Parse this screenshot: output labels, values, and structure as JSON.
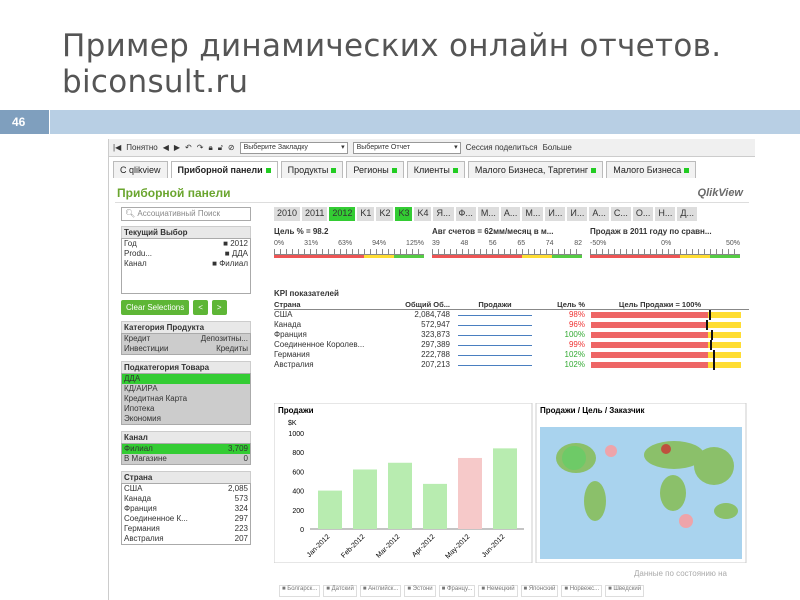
{
  "slide": {
    "title_line1": "Пример динамических онлайн отчетов.",
    "title_line2": "biconsult.ru",
    "page_num": "46"
  },
  "toolbar": {
    "understood": "Понятно",
    "bookmark": "Выберите Закладку",
    "report": "Выберите Отчет",
    "share": "Сессия поделиться",
    "more": "Больше"
  },
  "tabs": [
    "C qlikview",
    "Приборной панели",
    "Продукты",
    "Регионы",
    "Клиенты",
    "Малого Бизнеса, Таргетинг",
    "Малого Бизнеса"
  ],
  "sheet": {
    "title": "Приборной панели",
    "logo": "QlikView"
  },
  "left": {
    "search_placeholder": "Ассоциативный Поиск",
    "current_title": "Текущий Выбор",
    "current": [
      {
        "f": "Год",
        "v": "2012"
      },
      {
        "f": "Produ...",
        "v": "ДДА"
      },
      {
        "f": "Канал",
        "v": "Филиал"
      }
    ],
    "clear": "Clear Selections",
    "back": "<",
    "fwd": ">",
    "cat_title": "Категория Продукта",
    "cats": [
      [
        "Кредит",
        "Депозитны..."
      ],
      [
        "Инвестиции",
        "Кредиты"
      ]
    ],
    "subcat_title": "Подкатегория Товара",
    "subcats": [
      "ДДА",
      "КД/АИРА",
      "Кредитная Карта",
      "Ипотека",
      "Экономия"
    ],
    "channel_title": "Канал",
    "channels": [
      {
        "n": "Филиал",
        "v": "3,709"
      },
      {
        "n": "В Магазине",
        "v": "0"
      }
    ],
    "country_title": "Страна",
    "countries": [
      {
        "n": "США",
        "v": "2,085"
      },
      {
        "n": "Канада",
        "v": "573"
      },
      {
        "n": "Франция",
        "v": "324"
      },
      {
        "n": "Соединенное К...",
        "v": "297"
      },
      {
        "n": "Германия",
        "v": "223"
      },
      {
        "n": "Австралия",
        "v": "207"
      }
    ]
  },
  "years": [
    "2010",
    "2011",
    "2012",
    "K1",
    "K2",
    "K3",
    "K4",
    "Я...",
    "Ф...",
    "М...",
    "А...",
    "М...",
    "И...",
    "И...",
    "А...",
    "С...",
    "О...",
    "Н...",
    "Д..."
  ],
  "gauges": [
    {
      "title": "Цель % = 98.2",
      "ticks": [
        "0%",
        "31%",
        "63%",
        "94%",
        "125%"
      ]
    },
    {
      "title": "Авг счетов = 62мм/месяц в м...",
      "ticks": [
        "39",
        "48",
        "56",
        "65",
        "74",
        "82"
      ]
    },
    {
      "title": "Продаж в 2011 году по сравн...",
      "ticks": [
        "-50%",
        "0%",
        "50%"
      ]
    }
  ],
  "kpi": {
    "title": "KPI показателей",
    "headers": [
      "Страна",
      "Общий Об...",
      "Продажи",
      "Цель %",
      "Цель Продажи = 100%"
    ],
    "rows": [
      {
        "c": "США",
        "t": "2,084,748",
        "p": "98%",
        "w": 0.98
      },
      {
        "c": "Канада",
        "t": "572,947",
        "p": "96%",
        "w": 0.96
      },
      {
        "c": "Франция",
        "t": "323,873",
        "p": "100%",
        "w": 1.0
      },
      {
        "c": "Соединенное Королев...",
        "t": "297,389",
        "p": "99%",
        "w": 0.99
      },
      {
        "c": "Германия",
        "t": "222,788",
        "p": "102%",
        "w": 1.02
      },
      {
        "c": "Австралия",
        "t": "207,213",
        "p": "102%",
        "w": 1.02
      }
    ]
  },
  "map_title": "Продажи / Цель / Заказчик",
  "footer_langs": [
    "Болгарск...",
    "Датский",
    "Английск...",
    "Эстони",
    "Францу...",
    "Немецкий",
    "Японский",
    "Норвежс...",
    "Шведский"
  ],
  "note": "Данные по состоянию на",
  "chart_data": {
    "type": "bar",
    "title": "Продажи",
    "ylabel": "$K",
    "categories": [
      "Jan-2012",
      "Feb-2012",
      "Mar-2012",
      "Apr-2012",
      "May-2012",
      "Jun-2012"
    ],
    "values": [
      400,
      620,
      690,
      470,
      740,
      840
    ],
    "ylim": [
      0,
      1000
    ],
    "yticks": [
      0,
      200,
      400,
      600,
      800,
      1000
    ],
    "colors": [
      "#b8ecb0",
      "#b8ecb0",
      "#b8ecb0",
      "#b8ecb0",
      "#f6c9c9",
      "#b8ecb0"
    ]
  }
}
